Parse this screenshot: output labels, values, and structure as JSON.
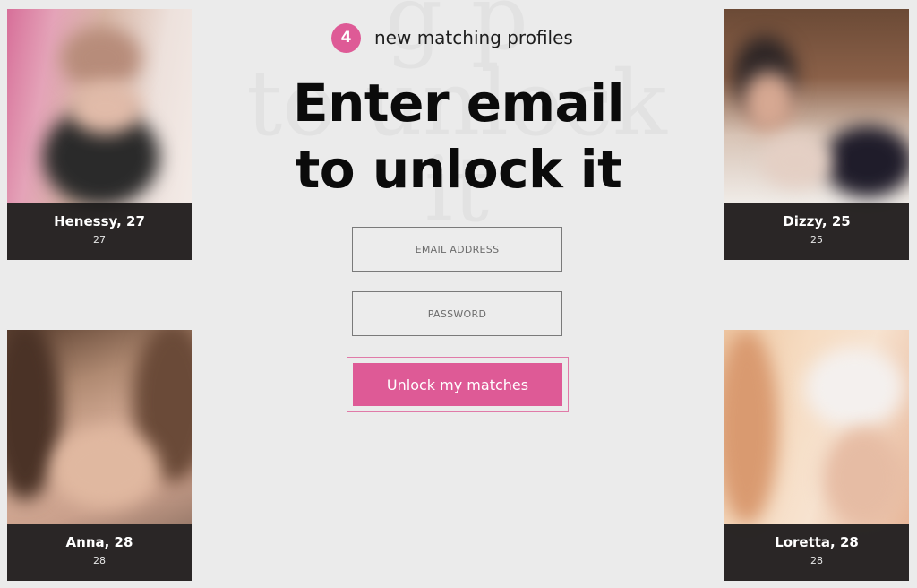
{
  "background_text": "g p to unlock it",
  "header": {
    "badge_count": "4",
    "badge_label": "new matching profiles",
    "title_line1": "Enter email",
    "title_line2": "to unlock it"
  },
  "form": {
    "email_placeholder": "EMAIL ADDRESS",
    "password_placeholder": "PASSWORD",
    "submit_label": "Unlock my matches"
  },
  "profiles": [
    {
      "name": "Henessy, 27",
      "age": "27"
    },
    {
      "name": "Dizzy, 25",
      "age": "25"
    },
    {
      "name": "Anna, 28",
      "age": "28"
    },
    {
      "name": "Loretta, 28",
      "age": "28"
    }
  ],
  "colors": {
    "accent": "#de5a96",
    "background": "#ebebeb",
    "card_footer": "#1c1a1a"
  }
}
